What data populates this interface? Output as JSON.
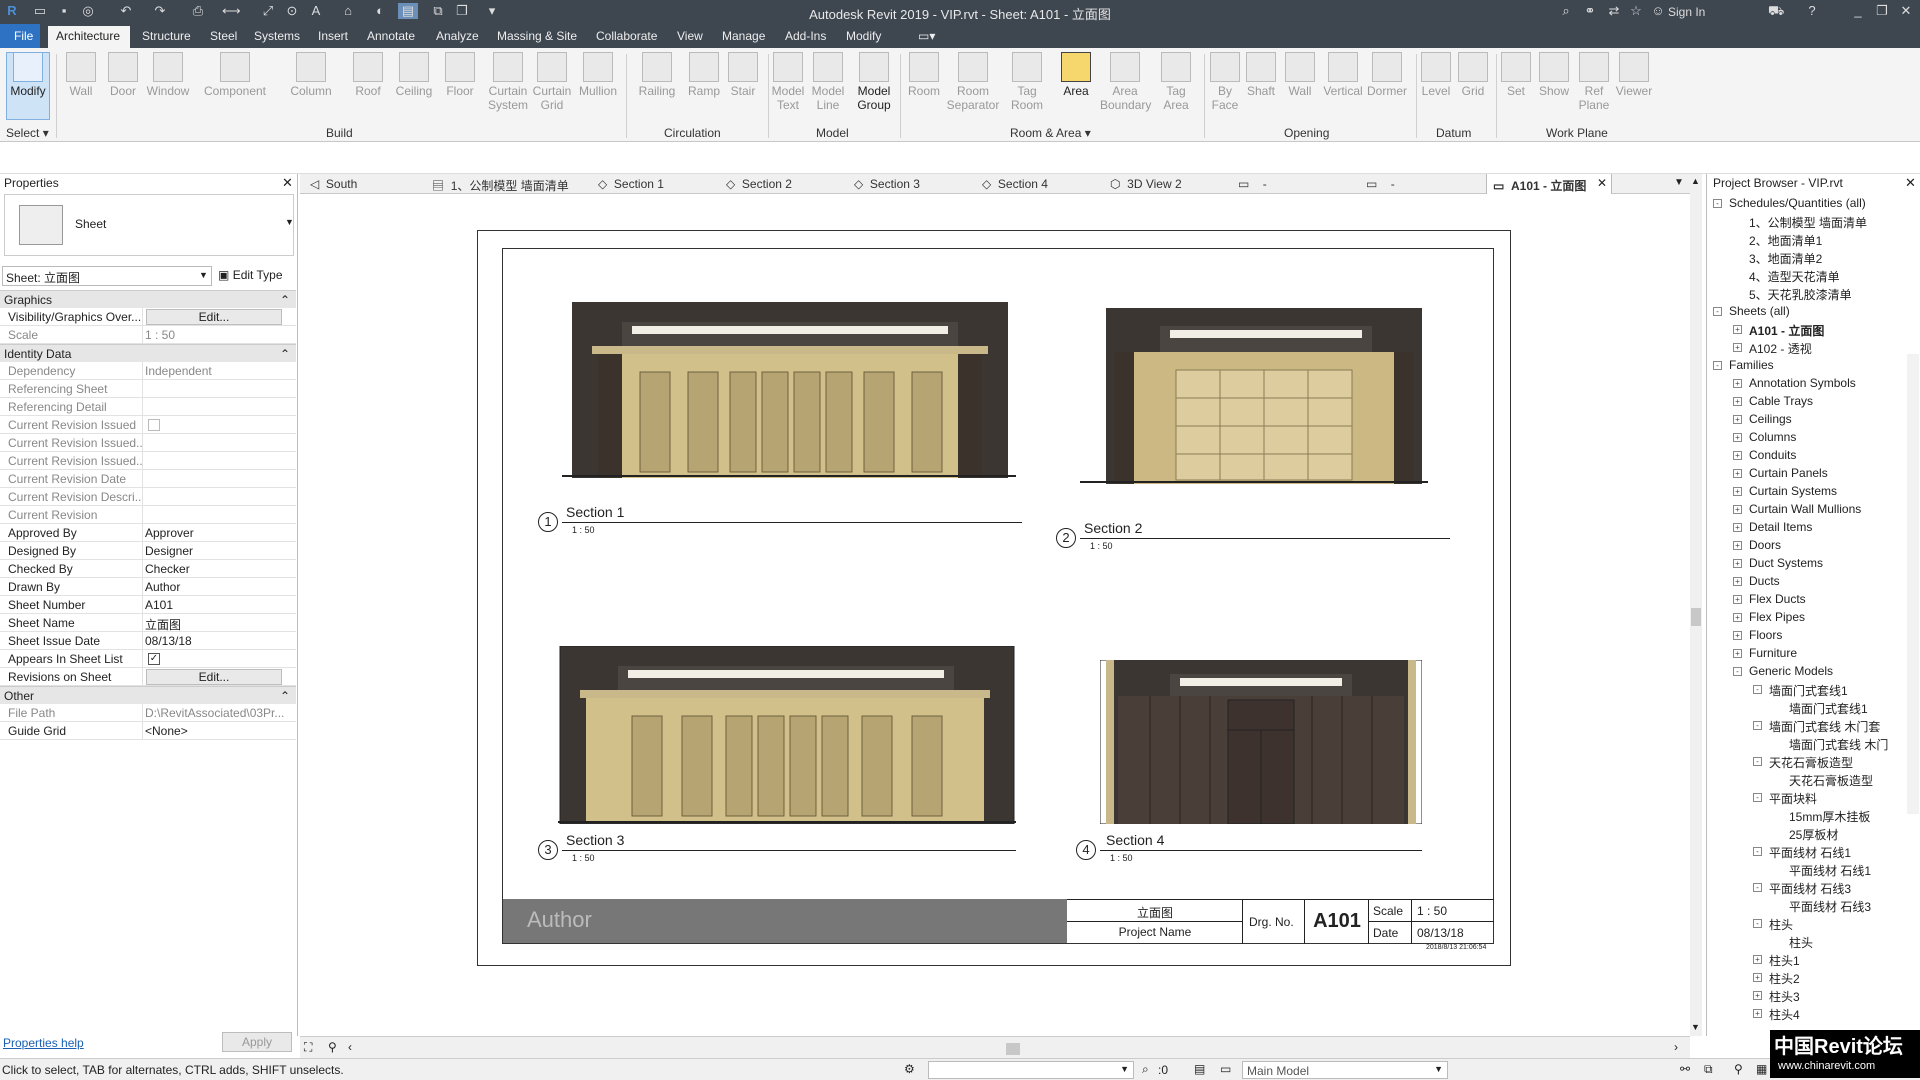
{
  "app": {
    "title": "Autodesk Revit 2019 - VIP.rvt - Sheet: A101 - 立面图",
    "sign_in": "Sign In"
  },
  "menu": {
    "file": "File",
    "items": [
      "Architecture",
      "Structure",
      "Steel",
      "Systems",
      "Insert",
      "Annotate",
      "Analyze",
      "Massing & Site",
      "Collaborate",
      "View",
      "Manage",
      "Add-Ins",
      "Modify"
    ]
  },
  "ribbon": {
    "tools": [
      {
        "label": "Modify",
        "sub": ""
      },
      {
        "label": "Wall",
        "sub": ""
      },
      {
        "label": "Door",
        "sub": ""
      },
      {
        "label": "Window",
        "sub": ""
      },
      {
        "label": "Component",
        "sub": ""
      },
      {
        "label": "Column",
        "sub": ""
      },
      {
        "label": "Roof",
        "sub": ""
      },
      {
        "label": "Ceiling",
        "sub": ""
      },
      {
        "label": "Floor",
        "sub": ""
      },
      {
        "label": "Curtain",
        "sub": "System"
      },
      {
        "label": "Curtain",
        "sub": "Grid"
      },
      {
        "label": "Mullion",
        "sub": ""
      },
      {
        "label": "Railing",
        "sub": ""
      },
      {
        "label": "Ramp",
        "sub": ""
      },
      {
        "label": "Stair",
        "sub": ""
      },
      {
        "label": "Model",
        "sub": "Text"
      },
      {
        "label": "Model",
        "sub": "Line"
      },
      {
        "label": "Model",
        "sub": "Group"
      },
      {
        "label": "Room",
        "sub": ""
      },
      {
        "label": "Room",
        "sub": "Separator"
      },
      {
        "label": "Tag",
        "sub": "Room"
      },
      {
        "label": "Area",
        "sub": ""
      },
      {
        "label": "Area",
        "sub": "Boundary"
      },
      {
        "label": "Tag",
        "sub": "Area"
      },
      {
        "label": "By",
        "sub": "Face"
      },
      {
        "label": "Shaft",
        "sub": ""
      },
      {
        "label": "Wall",
        "sub": ""
      },
      {
        "label": "Vertical",
        "sub": ""
      },
      {
        "label": "Dormer",
        "sub": ""
      },
      {
        "label": "Level",
        "sub": ""
      },
      {
        "label": "Grid",
        "sub": ""
      },
      {
        "label": "Set",
        "sub": ""
      },
      {
        "label": "Show",
        "sub": ""
      },
      {
        "label": "Ref",
        "sub": "Plane"
      },
      {
        "label": "Viewer",
        "sub": ""
      }
    ],
    "groups": {
      "select": "Select",
      "build": "Build",
      "circulation": "Circulation",
      "model": "Model",
      "room_area": "Room & Area",
      "opening": "Opening",
      "datum": "Datum",
      "work_plane": "Work Plane"
    }
  },
  "properties": {
    "title": "Properties",
    "type_name": "Sheet",
    "selector": "Sheet: 立面图",
    "edit_type": "Edit Type",
    "graphics": "Graphics",
    "identity": "Identity Data",
    "other": "Other",
    "rows": {
      "vis_k": "Visibility/Graphics Over...",
      "vis_v": "Edit...",
      "scale_k": "Scale",
      "scale_v": "1 : 50",
      "dep_k": "Dependency",
      "dep_v": "Independent",
      "refs_k": "Referencing Sheet",
      "refd_k": "Referencing Detail",
      "cri_k": "Current Revision Issued",
      "crib_k": "Current Revision Issued...",
      "cric_k": "Current Revision Issued...",
      "crd_k": "Current Revision Date",
      "crde_k": "Current Revision Descri...",
      "cr_k": "Current Revision",
      "app_k": "Approved By",
      "app_v": "Approver",
      "des_k": "Designed By",
      "des_v": "Designer",
      "chk_k": "Checked By",
      "chk_v": "Checker",
      "drw_k": "Drawn By",
      "drw_v": "Author",
      "snum_k": "Sheet Number",
      "snum_v": "A101",
      "sname_k": "Sheet Name",
      "sname_v": "立面图",
      "sdate_k": "Sheet Issue Date",
      "sdate_v": "08/13/18",
      "asl_k": "Appears In Sheet List",
      "ros_k": "Revisions on Sheet",
      "ros_v": "Edit...",
      "fp_k": "File Path",
      "fp_v": "D:\\RevitAssociated\\03Pr...",
      "gg_k": "Guide Grid",
      "gg_v": "<None>"
    },
    "help": "Properties help",
    "apply": "Apply"
  },
  "tabs": [
    "South",
    "1、公制模型 墙面清单",
    "Section 1",
    "Section 2",
    "Section 3",
    "Section 4",
    "3D View 2",
    "-",
    "-",
    "A101 - 立面图"
  ],
  "sheet": {
    "views": [
      {
        "num": "1",
        "name": "Section 1",
        "scale": "1 : 50"
      },
      {
        "num": "2",
        "name": "Section 2",
        "scale": "1 : 50"
      },
      {
        "num": "3",
        "name": "Section 3",
        "scale": "1 : 50"
      },
      {
        "num": "4",
        "name": "Section 4",
        "scale": "1 : 50"
      }
    ],
    "titleblock": {
      "author": "Author",
      "sheet_name": "立面图",
      "project": "Project Name",
      "drg_label": "Drg. No.",
      "number": "A101",
      "scale_label": "Scale",
      "scale": "1 : 50",
      "date_label": "Date",
      "date": "08/13/18",
      "stamp": "2018/8/13 21:06:54"
    }
  },
  "browser": {
    "title": "Project Browser - VIP.rvt",
    "nodes": [
      {
        "t": "Schedules/Quantities (all)",
        "lvl": 0,
        "e": "-"
      },
      {
        "t": "1、公制模型 墙面清单",
        "lvl": 1,
        "e": ""
      },
      {
        "t": "2、地面清单1",
        "lvl": 1,
        "e": ""
      },
      {
        "t": "3、地面清单2",
        "lvl": 1,
        "e": ""
      },
      {
        "t": "4、造型天花清单",
        "lvl": 1,
        "e": ""
      },
      {
        "t": "5、天花乳胶漆清单",
        "lvl": 1,
        "e": ""
      },
      {
        "t": "Sheets (all)",
        "lvl": 0,
        "e": "-"
      },
      {
        "t": "A101 - 立面图",
        "lvl": 1,
        "e": "+",
        "bold": true
      },
      {
        "t": "A102 - 透视",
        "lvl": 1,
        "e": "+"
      },
      {
        "t": "Families",
        "lvl": 0,
        "e": "-"
      },
      {
        "t": "Annotation Symbols",
        "lvl": 1,
        "e": "+"
      },
      {
        "t": "Cable Trays",
        "lvl": 1,
        "e": "+"
      },
      {
        "t": "Ceilings",
        "lvl": 1,
        "e": "+"
      },
      {
        "t": "Columns",
        "lvl": 1,
        "e": "+"
      },
      {
        "t": "Conduits",
        "lvl": 1,
        "e": "+"
      },
      {
        "t": "Curtain Panels",
        "lvl": 1,
        "e": "+"
      },
      {
        "t": "Curtain Systems",
        "lvl": 1,
        "e": "+"
      },
      {
        "t": "Curtain Wall Mullions",
        "lvl": 1,
        "e": "+"
      },
      {
        "t": "Detail Items",
        "lvl": 1,
        "e": "+"
      },
      {
        "t": "Doors",
        "lvl": 1,
        "e": "+"
      },
      {
        "t": "Duct Systems",
        "lvl": 1,
        "e": "+"
      },
      {
        "t": "Ducts",
        "lvl": 1,
        "e": "+"
      },
      {
        "t": "Flex Ducts",
        "lvl": 1,
        "e": "+"
      },
      {
        "t": "Flex Pipes",
        "lvl": 1,
        "e": "+"
      },
      {
        "t": "Floors",
        "lvl": 1,
        "e": "+"
      },
      {
        "t": "Furniture",
        "lvl": 1,
        "e": "+"
      },
      {
        "t": "Generic Models",
        "lvl": 1,
        "e": "-"
      },
      {
        "t": "墙面门式套线1",
        "lvl": 2,
        "e": "-"
      },
      {
        "t": "墙面门式套线1",
        "lvl": 3,
        "e": ""
      },
      {
        "t": "墙面门式套线 木门套",
        "lvl": 2,
        "e": "-"
      },
      {
        "t": "墙面门式套线 木门",
        "lvl": 3,
        "e": ""
      },
      {
        "t": "天花石膏板造型",
        "lvl": 2,
        "e": "-"
      },
      {
        "t": "天花石膏板造型",
        "lvl": 3,
        "e": ""
      },
      {
        "t": "平面块料",
        "lvl": 2,
        "e": "-"
      },
      {
        "t": "15mm厚木挂板",
        "lvl": 3,
        "e": ""
      },
      {
        "t": "25厚板材",
        "lvl": 3,
        "e": ""
      },
      {
        "t": "平面线材 石线1",
        "lvl": 2,
        "e": "-"
      },
      {
        "t": "平面线材 石线1",
        "lvl": 3,
        "e": ""
      },
      {
        "t": "平面线材 石线3",
        "lvl": 2,
        "e": "-"
      },
      {
        "t": "平面线材 石线3",
        "lvl": 3,
        "e": ""
      },
      {
        "t": "柱头",
        "lvl": 2,
        "e": "-"
      },
      {
        "t": "柱头",
        "lvl": 3,
        "e": ""
      },
      {
        "t": "柱头1",
        "lvl": 2,
        "e": "+"
      },
      {
        "t": "柱头2",
        "lvl": 2,
        "e": "+"
      },
      {
        "t": "柱头3",
        "lvl": 2,
        "e": "+"
      },
      {
        "t": "柱头4",
        "lvl": 2,
        "e": "+"
      }
    ]
  },
  "status": {
    "hint": "Click to select, TAB for alternates, CTRL adds, SHIFT unselects.",
    "zero": ":0",
    "model": "Main Model"
  },
  "watermark": {
    "line1": "中国Revit论坛",
    "line2": "www.chinarevit.com"
  }
}
